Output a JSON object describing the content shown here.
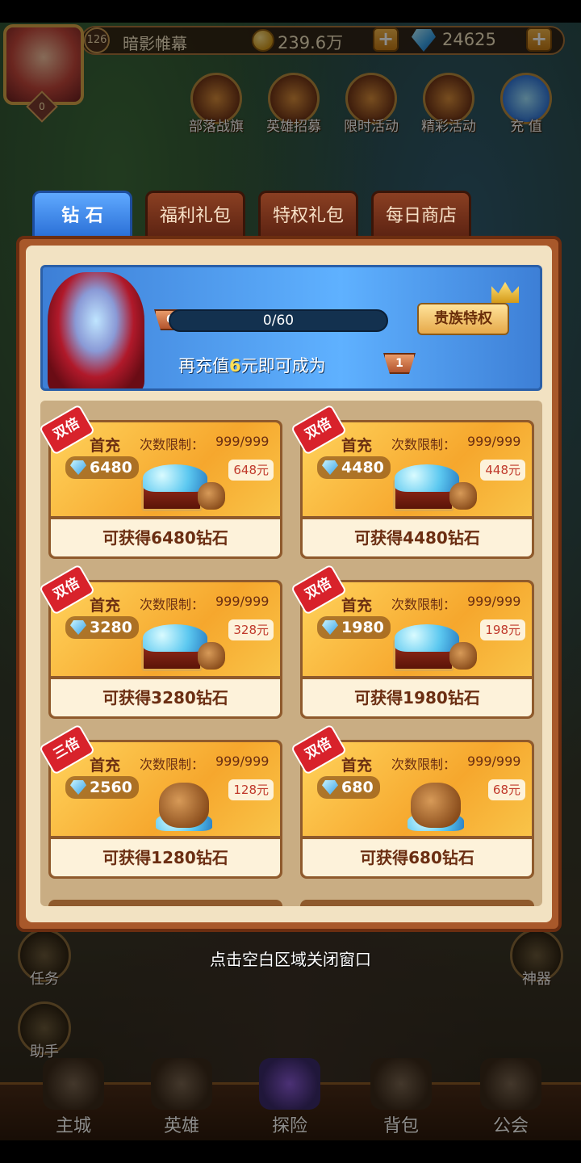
{
  "hud": {
    "level": "126",
    "player_name": "暗影帷幕",
    "gold": "239.6万",
    "gems": "24625",
    "plus_label": "+",
    "avatar_badge": "0"
  },
  "top_nav": [
    {
      "label": "部落战旗"
    },
    {
      "label": "英雄招募"
    },
    {
      "label": "限时活动"
    },
    {
      "label": "精彩活动"
    },
    {
      "label": "充 值"
    }
  ],
  "side": {
    "task": "任务",
    "helper": "助手",
    "artifact": "神器"
  },
  "bottom_nav": [
    {
      "label": "主城"
    },
    {
      "label": "英雄"
    },
    {
      "label": "探险"
    },
    {
      "label": "背包"
    },
    {
      "label": "公会"
    }
  ],
  "tabs": [
    {
      "label": "钻 石",
      "active": true
    },
    {
      "label": "福利礼包",
      "active": false
    },
    {
      "label": "特权礼包",
      "active": false
    },
    {
      "label": "每日商店",
      "active": false
    }
  ],
  "vip": {
    "current_level": "0",
    "next_level": "1",
    "progress_text": "0/60",
    "progress_fraction": 0,
    "button_label": "贵族特权",
    "tip_prefix": "再充值",
    "tip_amount": "6",
    "tip_suffix": "元即可成为"
  },
  "products": [
    {
      "ribbon": "双倍",
      "first": "首充",
      "limit_label": "次数限制：",
      "limit": "999/999",
      "gems": "6480",
      "price": "648元",
      "reward": "可获得6480钻石",
      "art": "chest"
    },
    {
      "ribbon": "双倍",
      "first": "首充",
      "limit_label": "次数限制：",
      "limit": "999/999",
      "gems": "4480",
      "price": "448元",
      "reward": "可获得4480钻石",
      "art": "chest"
    },
    {
      "ribbon": "双倍",
      "first": "首充",
      "limit_label": "次数限制：",
      "limit": "999/999",
      "gems": "3280",
      "price": "328元",
      "reward": "可获得3280钻石",
      "art": "chest"
    },
    {
      "ribbon": "双倍",
      "first": "首充",
      "limit_label": "次数限制：",
      "limit": "999/999",
      "gems": "1980",
      "price": "198元",
      "reward": "可获得1980钻石",
      "art": "chest"
    },
    {
      "ribbon": "三倍",
      "first": "首充",
      "limit_label": "次数限制：",
      "limit": "999/999",
      "gems": "2560",
      "price": "128元",
      "reward": "可获得1280钻石",
      "art": "sack"
    },
    {
      "ribbon": "双倍",
      "first": "首充",
      "limit_label": "次数限制：",
      "limit": "999/999",
      "gems": "680",
      "price": "68元",
      "reward": "可获得680钻石",
      "art": "sack"
    }
  ],
  "close_hint": "点击空白区域关闭窗口"
}
